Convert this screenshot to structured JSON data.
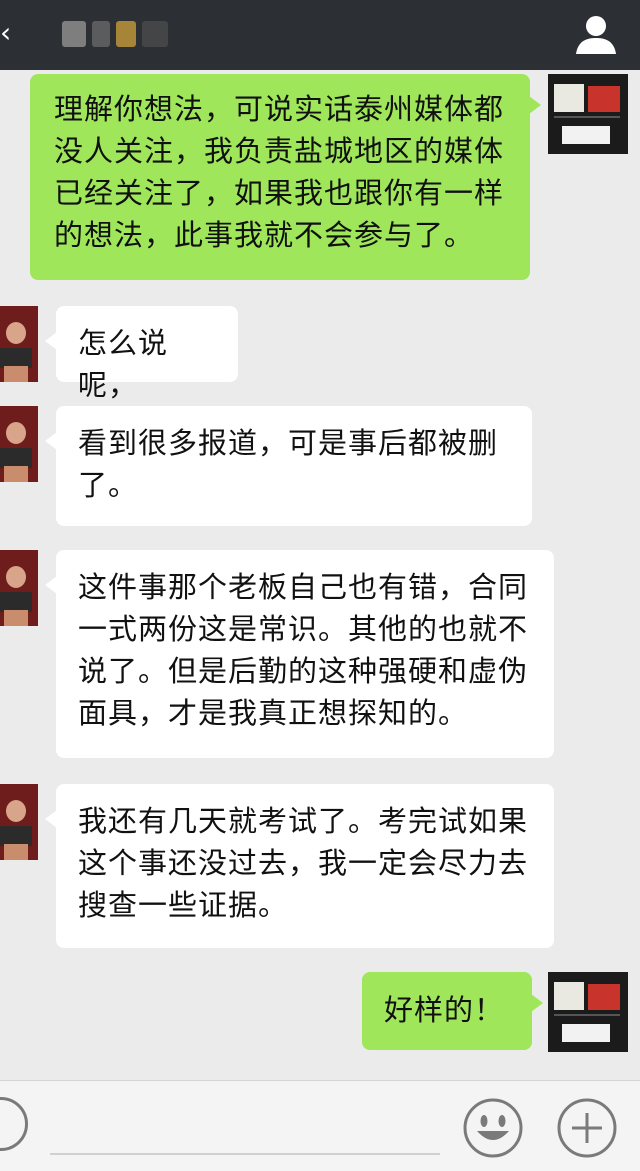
{
  "header": {
    "back_icon": "back-arrow-icon",
    "profile_icon": "person-icon"
  },
  "messages": [
    {
      "sender": "me",
      "text": "理解你想法，可说实话泰州媒体都没人关注，我负责盐城地区的媒体已经关注了，如果我也跟你有一样的想法，此事我就不会参与了。"
    },
    {
      "sender": "other",
      "text": "怎么说呢，"
    },
    {
      "sender": "other",
      "text": "看到很多报道，可是事后都被删了。"
    },
    {
      "sender": "other",
      "text": "这件事那个老板自己也有错，合同一式两份这是常识。其他的也就不说了。但是后勤的这种强硬和虚伪面具，才是我真正想探知的。"
    },
    {
      "sender": "other",
      "text": "我还有几天就考试了。考完试如果这个事还没过去，我一定会尽力去搜查一些证据。"
    },
    {
      "sender": "me",
      "text": "好样的！"
    }
  ],
  "input_bar": {
    "voice_icon": "voice-icon",
    "emoji_icon": "emoji-icon",
    "more_icon": "plus-icon"
  },
  "colors": {
    "header_bg": "#2c2f33",
    "chat_bg": "#ebebeb",
    "my_bubble": "#9fe65a",
    "other_bubble": "#ffffff"
  }
}
